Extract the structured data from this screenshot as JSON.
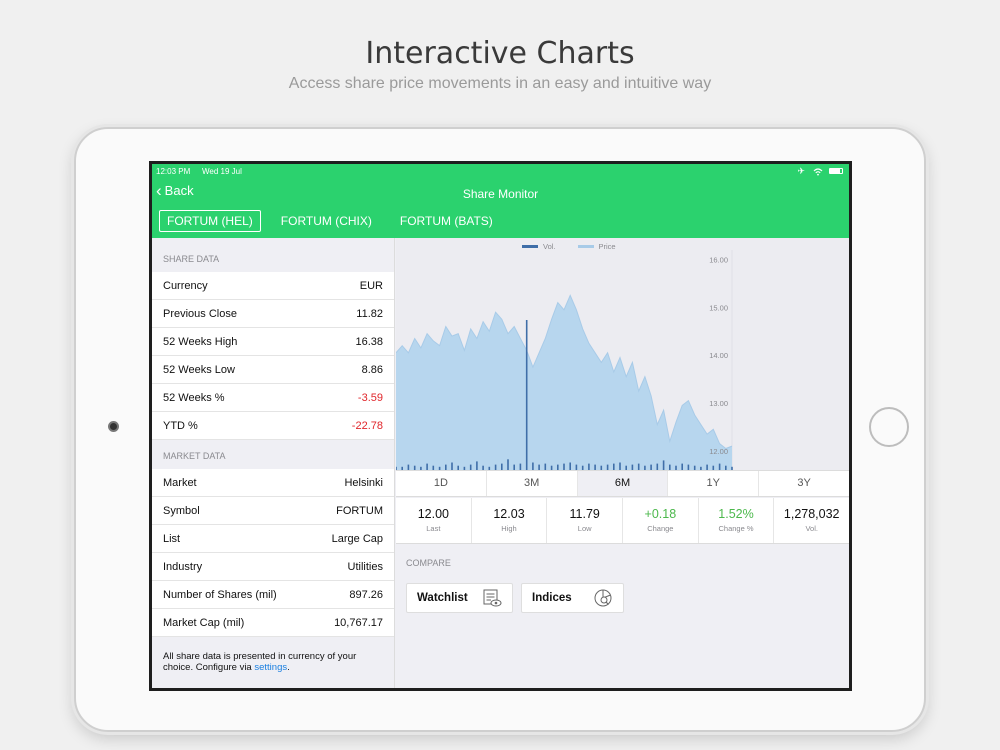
{
  "hero": {
    "title": "Interactive Charts",
    "subtitle": "Access share price movements in an easy and intuitive way"
  },
  "status": {
    "time": "12:03 PM",
    "date": "Wed 19 Jul"
  },
  "nav": {
    "back_label": "Back",
    "title": "Share Monitor",
    "tabs": [
      "FORTUM (HEL)",
      "FORTUM (CHIX)",
      "FORTUM (BATS)"
    ]
  },
  "share_data": {
    "header": "SHARE DATA",
    "rows": [
      {
        "label": "Currency",
        "value": "EUR"
      },
      {
        "label": "Previous Close",
        "value": "11.82"
      },
      {
        "label": "52 Weeks High",
        "value": "16.38"
      },
      {
        "label": "52 Weeks Low",
        "value": "8.86"
      },
      {
        "label": "52 Weeks %",
        "value": "-3.59"
      },
      {
        "label": "YTD %",
        "value": "-22.78"
      }
    ]
  },
  "market_data": {
    "header": "MARKET DATA",
    "rows": [
      {
        "label": "Market",
        "value": "Helsinki"
      },
      {
        "label": "Symbol",
        "value": "FORTUM"
      },
      {
        "label": "List",
        "value": "Large Cap"
      },
      {
        "label": "Industry",
        "value": "Utilities"
      },
      {
        "label": "Number of Shares (mil)",
        "value": "897.26"
      },
      {
        "label": "Market Cap (mil)",
        "value": "10,767.17"
      }
    ]
  },
  "footnote": {
    "text": "All share data is presented in currency of your choice. Configure via ",
    "link": "settings",
    "end": "."
  },
  "ranges": [
    "1D",
    "3M",
    "6M",
    "1Y",
    "3Y"
  ],
  "stats": [
    {
      "value": "12.00",
      "label": "Last"
    },
    {
      "value": "12.03",
      "label": "High"
    },
    {
      "value": "11.79",
      "label": "Low"
    },
    {
      "value": "+0.18",
      "label": "Change"
    },
    {
      "value": "1.52%",
      "label": "Change %"
    },
    {
      "value": "1,278,032",
      "label": "Vol."
    }
  ],
  "compare": {
    "header": "COMPARE",
    "watchlist": "Watchlist",
    "indices": "Indices"
  },
  "colors": {
    "nav_green": "#2bd26e",
    "price_fill": "#b7d6ee",
    "price_line": "#a8cbe8",
    "volume": "#3f6ea8",
    "negative": "#e0262b",
    "positive": "#4cb84c"
  },
  "chart_data": {
    "type": "area",
    "series": [
      {
        "name": "Price",
        "values": [
          14.05,
          14.2,
          14.05,
          14.35,
          14.15,
          14.45,
          14.3,
          14.2,
          14.6,
          14.4,
          14.45,
          14.1,
          14.55,
          14.35,
          14.7,
          14.5,
          14.9,
          14.75,
          14.45,
          14.6,
          14.35,
          14.1,
          13.75,
          14.05,
          14.35,
          14.75,
          15.1,
          14.95,
          15.25,
          14.95,
          14.55,
          14.25,
          14.05,
          13.85,
          14.05,
          13.65,
          13.95,
          13.55,
          13.85,
          13.25,
          13.55,
          13.15,
          12.55,
          12.85,
          12.2,
          12.6,
          12.95,
          13.05,
          12.75,
          12.55,
          12.35,
          12.45,
          12.15,
          12.05,
          12.1
        ]
      },
      {
        "name": "Vol.",
        "values": [
          0.3,
          0.3,
          0.5,
          0.4,
          0.3,
          0.6,
          0.4,
          0.3,
          0.5,
          0.7,
          0.4,
          0.3,
          0.5,
          0.8,
          0.4,
          0.3,
          0.5,
          0.6,
          1.0,
          0.5,
          0.6,
          3.5,
          0.7,
          0.5,
          0.6,
          0.4,
          0.5,
          0.6,
          0.7,
          0.5,
          0.4,
          0.6,
          0.5,
          0.4,
          0.5,
          0.6,
          0.7,
          0.4,
          0.5,
          0.6,
          0.4,
          0.5,
          0.6,
          0.9,
          0.5,
          0.4,
          0.6,
          0.5,
          0.4,
          0.3,
          0.5,
          0.4,
          0.6,
          0.4,
          0.3
        ]
      }
    ],
    "yticks": [
      "16.00",
      "15.00",
      "14.00",
      "13.00",
      "12.00"
    ],
    "ylim": [
      11.6,
      16.2
    ],
    "legend": [
      "Vol.",
      "Price"
    ],
    "legend_position": "top-center"
  }
}
